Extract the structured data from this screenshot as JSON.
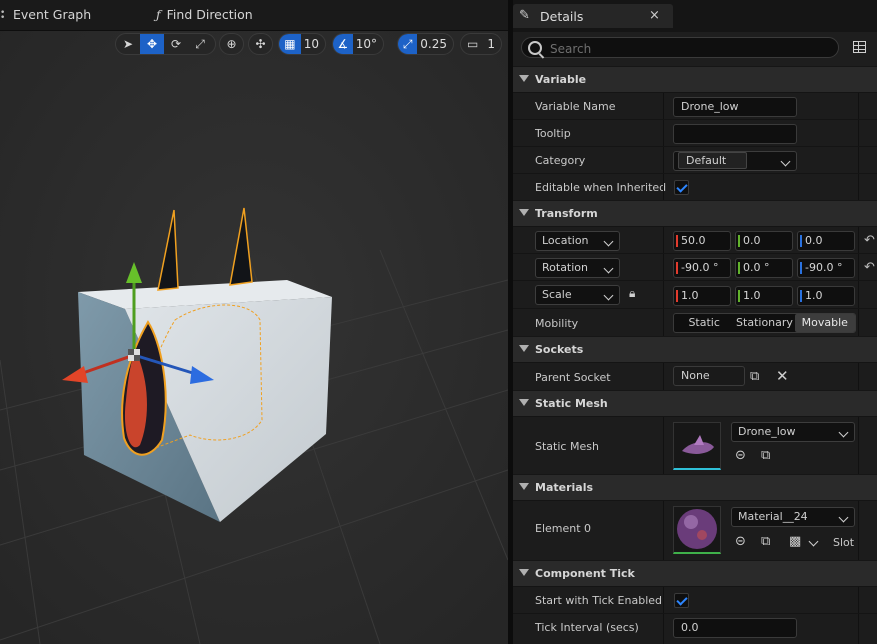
{
  "viewport_tabs": [
    {
      "label": "Event Graph"
    },
    {
      "label": "Find Direction",
      "glyph": "ƒ"
    }
  ],
  "toolbar": {
    "grid_snap_value": "10",
    "rotation_snap_value": "10°",
    "scale_snap_value": "0.25",
    "camera_speed_value": "1"
  },
  "details": {
    "tab_title": "Details",
    "close_glyph": "×",
    "search_placeholder": "Search",
    "sections": {
      "variable": "Variable",
      "transform": "Transform",
      "sockets": "Sockets",
      "static_mesh": "Static Mesh",
      "materials": "Materials",
      "component_tick": "Component Tick"
    },
    "variable": {
      "name_label": "Variable Name",
      "name_value": "Drone_low",
      "tooltip_label": "Tooltip",
      "tooltip_value": "",
      "category_label": "Category",
      "category_value": "Default",
      "editable_label": "Editable when Inherited",
      "editable_checked": true
    },
    "transform": {
      "location_label": "Location",
      "location": [
        "50.0",
        "0.0",
        "0.0"
      ],
      "rotation_label": "Rotation",
      "rotation": [
        "-90.0 °",
        "0.0 °",
        "-90.0 °"
      ],
      "scale_label": "Scale",
      "scale": [
        "1.0",
        "1.0",
        "1.0"
      ],
      "mobility_label": "Mobility",
      "mobility_options": [
        "Static",
        "Stationary",
        "Movable"
      ],
      "mobility_selected": "Movable"
    },
    "sockets": {
      "parent_label": "Parent Socket",
      "parent_value": "None"
    },
    "static_mesh": {
      "label": "Static Mesh",
      "value": "Drone_low"
    },
    "materials": {
      "label": "Element 0",
      "value": "Material__24",
      "slot_label": "Slot"
    },
    "component_tick": {
      "start_label": "Start with Tick Enabled",
      "start_checked": true,
      "interval_label": "Tick Interval (secs)",
      "interval_value": "0.0"
    }
  },
  "colors": {
    "accent": "#1d62c7",
    "selection_outline": "#f0a020",
    "cube_face": "#cfd6dc"
  }
}
